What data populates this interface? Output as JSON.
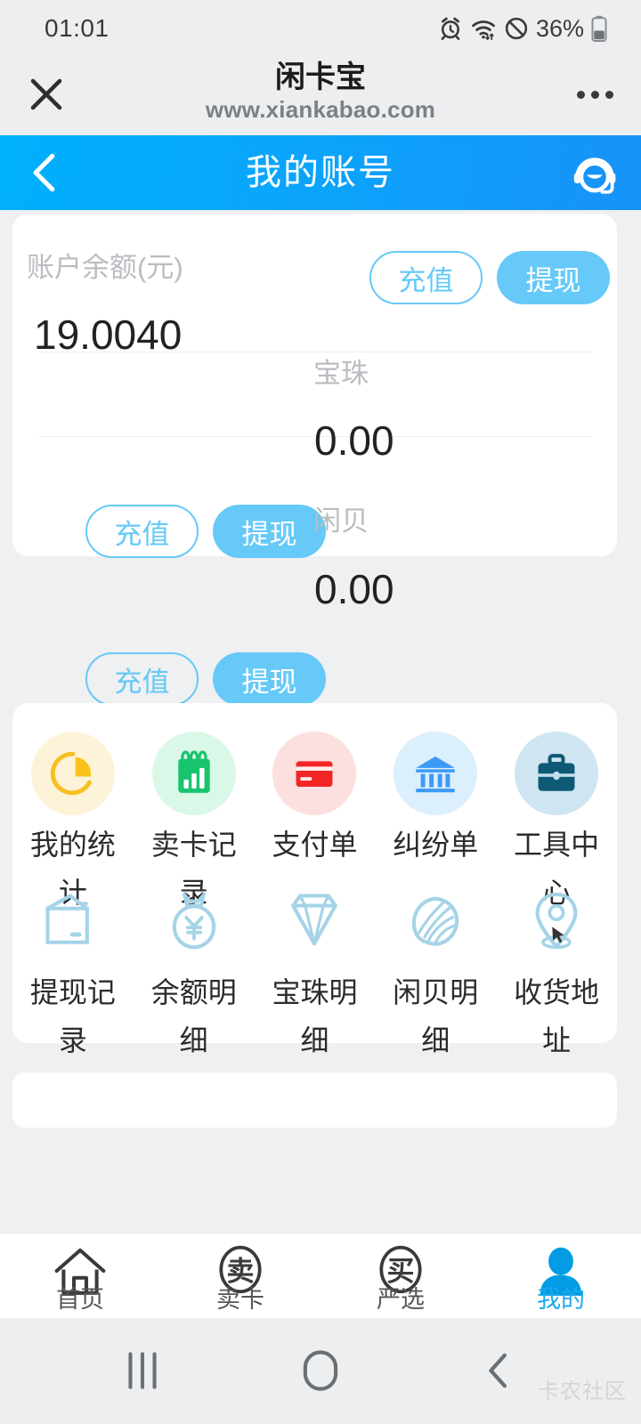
{
  "status_bar": {
    "time": "01:01",
    "battery_percent": "36%",
    "icons": [
      "alarm-icon",
      "wifi-icon",
      "do-not-disturb-icon",
      "battery-icon"
    ]
  },
  "browser_chrome": {
    "close_label": "close-icon",
    "title": "闲卡宝",
    "url": "www.xiankabao.com",
    "menu_label": "more-options-icon"
  },
  "app_header": {
    "back_label": "back-icon",
    "title": "我的账号",
    "service_label": "customer-service-icon"
  },
  "balance_card": {
    "blocks": [
      {
        "label": "账户余额(元)",
        "value": "19.0040",
        "recharge": "充值",
        "withdraw": "提现"
      },
      {
        "label": "宝珠",
        "value": "0.00",
        "recharge": "充值",
        "withdraw": "提现"
      },
      {
        "label": "闲贝",
        "value": "0.00",
        "recharge": "充值",
        "withdraw": "提现"
      }
    ]
  },
  "grid_card": {
    "row1": [
      {
        "label": "我的统计",
        "icon": "pie-chart-icon",
        "bg": "#FDF3D8",
        "fg": "#F7C020"
      },
      {
        "label": "卖卡记录",
        "icon": "bar-chart-notepad-icon",
        "bg": "#D9F8E7",
        "fg": "#19C46F"
      },
      {
        "label": "支付单",
        "icon": "credit-card-icon",
        "bg": "#FCDFDF",
        "fg": "#F42525"
      },
      {
        "label": "纠纷单",
        "icon": "bank-icon",
        "bg": "#DCEFFC",
        "fg": "#3D9AF7"
      },
      {
        "label": "工具中心",
        "icon": "briefcase-icon",
        "bg": "#CFE6F2",
        "fg": "#0E5A75"
      }
    ],
    "row2": [
      {
        "label": "提现记录",
        "icon": "wallet-icon",
        "fg": "#A8D5E8"
      },
      {
        "label": "余额明细",
        "icon": "money-bag-icon",
        "fg": "#A8D5E8"
      },
      {
        "label": "宝珠明细",
        "icon": "diamond-icon",
        "fg": "#A8D5E8"
      },
      {
        "label": "闲贝明细",
        "icon": "shell-icon",
        "fg": "#A8D5E8"
      },
      {
        "label": "收货地址",
        "icon": "location-pin-icon",
        "fg": "#A8D5E8"
      }
    ]
  },
  "tab_bar": {
    "items": [
      {
        "label": "首页",
        "icon": "home-icon",
        "active": false
      },
      {
        "label": "卖卡",
        "icon": "sell-card-icon",
        "active": false
      },
      {
        "label": "严选",
        "icon": "buy-select-icon",
        "active": false
      },
      {
        "label": "我的",
        "icon": "user-icon",
        "active": true
      }
    ]
  },
  "android_nav": {
    "recents": "recents-icon",
    "home": "home-circle-icon",
    "back": "back-chevron-icon"
  },
  "watermark": "卡农社区",
  "colors": {
    "header_blue_start": "#00b0fb",
    "header_blue_end": "#1792f8",
    "accent_button": "#66c9f7",
    "active_tab": "#19a9f0",
    "page_bg": "#eef0f1"
  }
}
